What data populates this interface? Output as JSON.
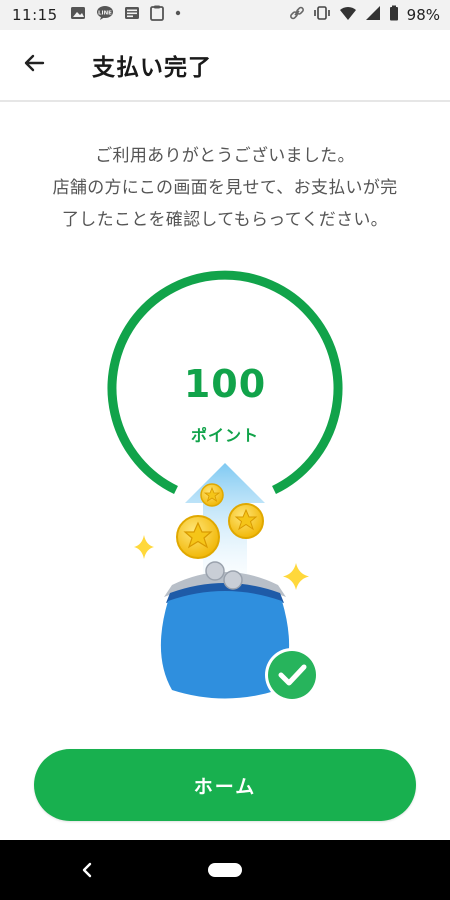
{
  "status_bar": {
    "time": "11:15",
    "battery": "98%",
    "left_icons": [
      "image-icon",
      "line-icon",
      "news-icon",
      "clipboard-icon",
      "dot-icon"
    ],
    "right_icons": [
      "link-icon",
      "vibrate-icon",
      "wifi-icon",
      "signal-icon",
      "battery-icon"
    ]
  },
  "app_bar": {
    "title": "支払い完了",
    "back_icon": "arrow-left-icon"
  },
  "message": {
    "line1": "ご利用ありがとうございました。",
    "line2": "店舗の方にこの画面を見せて、お支払いが完",
    "line3": "了したことを確認してもらってください。"
  },
  "points": {
    "value": "100",
    "unit": "ポイント"
  },
  "illustration": {
    "icons": [
      "arrow-up-icon",
      "coin-icon",
      "sparkle-icon",
      "purse-icon",
      "check-circle-icon"
    ]
  },
  "home_button": {
    "label": "ホーム"
  },
  "nav_bar": {
    "icons": [
      "nav-back-icon",
      "nav-home-icon"
    ]
  },
  "colors": {
    "accent_green": "#18b04f",
    "points_green": "#11a34a",
    "purse_blue": "#2f8fde",
    "coin_gold": "#f4c21c"
  }
}
